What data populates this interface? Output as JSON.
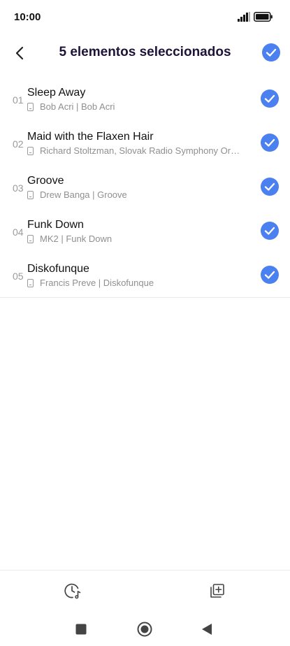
{
  "status_bar": {
    "time": "10:00"
  },
  "header": {
    "title": "5 elementos seleccionados"
  },
  "colors": {
    "accent": "#4a80ef",
    "title": "#1e1438"
  },
  "tracks": [
    {
      "number": "01",
      "title": "Sleep Away",
      "subtitle": "Bob Acri | Bob Acri",
      "selected": true
    },
    {
      "number": "02",
      "title": "Maid with the Flaxen Hair",
      "subtitle": "Richard Stoltzman, Slovak Radio Symphony Orch…",
      "selected": true
    },
    {
      "number": "03",
      "title": "Groove",
      "subtitle": "Drew Banga | Groove",
      "selected": true
    },
    {
      "number": "04",
      "title": "Funk Down",
      "subtitle": "MK2 | Funk Down",
      "selected": true
    },
    {
      "number": "05",
      "title": "Diskofunque",
      "subtitle": "Francis Preve | Diskofunque",
      "selected": true
    }
  ],
  "toolbar": {
    "left_icon": "clock-music-icon",
    "right_icon": "add-to-playlist-icon"
  },
  "navbar": {
    "icons": [
      "square-recents-icon",
      "circle-home-icon",
      "triangle-back-icon"
    ]
  }
}
